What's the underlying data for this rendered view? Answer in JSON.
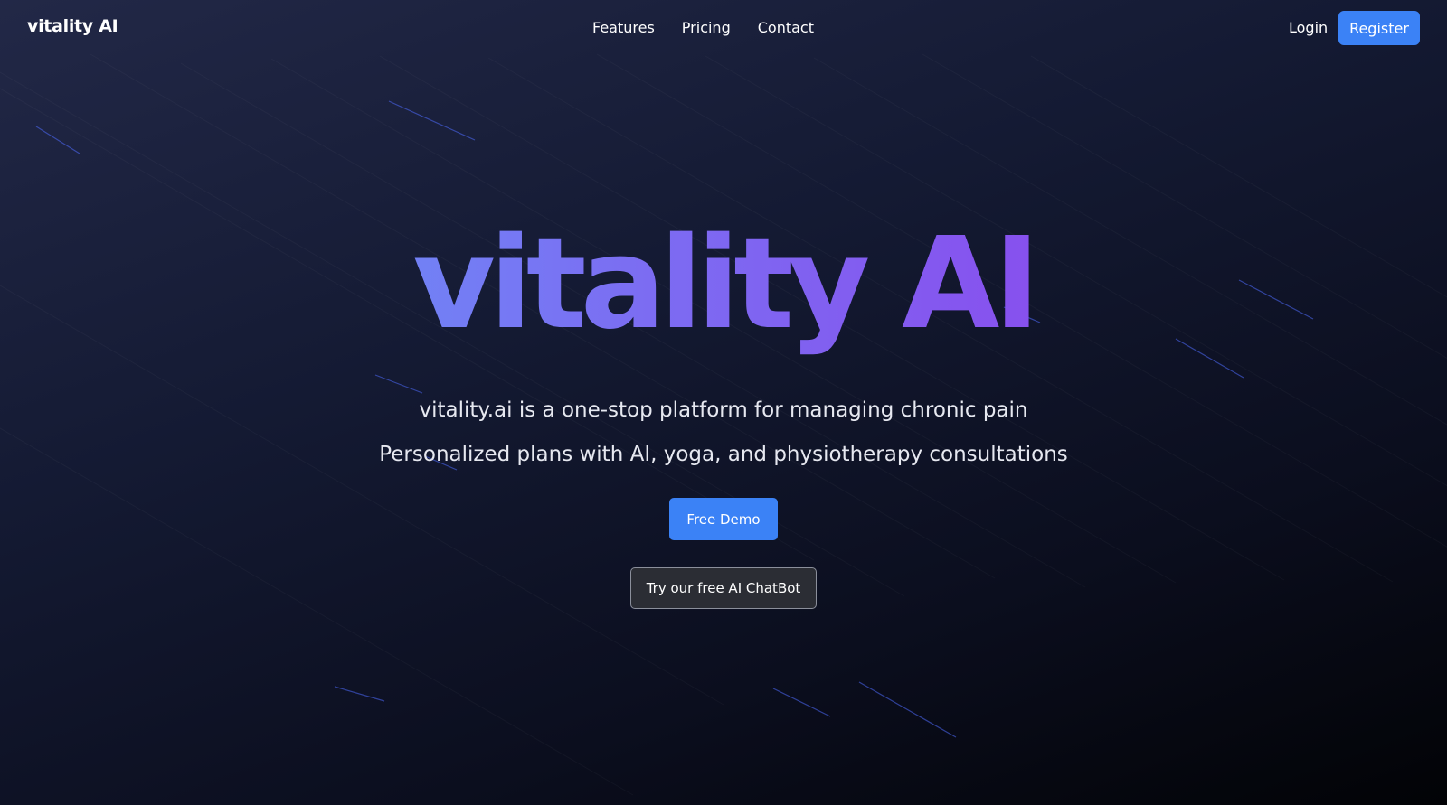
{
  "nav": {
    "brand": "vitality AI",
    "links": [
      "Features",
      "Pricing",
      "Contact"
    ],
    "login": "Login",
    "register": "Register"
  },
  "hero": {
    "title": "vitality AI",
    "subtitle_1": "vitality.ai is a one-stop platform for managing chronic pain",
    "subtitle_2": "Personalized plans with AI, yoga, and physiotherapy consultations",
    "demo_button": "Free Demo",
    "chatbot_button": "Try our free AI ChatBot"
  },
  "colors": {
    "accent": "#3b82f6",
    "gradient_start": "#60a5fa",
    "gradient_end": "#9333ea",
    "background_dark": "#020306"
  }
}
